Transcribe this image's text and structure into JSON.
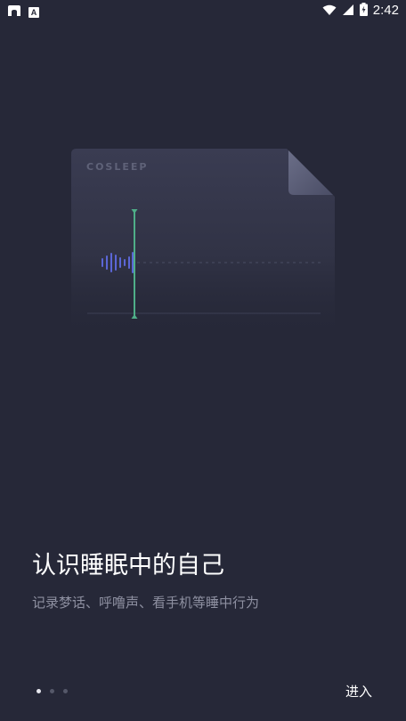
{
  "status_bar": {
    "time": "2:42",
    "icons": [
      "app-gallery-icon",
      "app-a-icon",
      "wifi-icon",
      "cell-signal-icon",
      "battery-charging-icon"
    ],
    "app_badge_letter": "A"
  },
  "illustration": {
    "doc_label": "COSLEEP",
    "icon": "sleep-recording-document-icon",
    "accent_color": "#4fae88",
    "wave_color": "#5b66d6"
  },
  "onboarding": {
    "headline": "认识睡眠中的自己",
    "subline": "记录梦话、呼噜声、看手机等睡中行为",
    "page_count": 3,
    "current_page": 1
  },
  "actions": {
    "enter_label": "进入"
  },
  "colors": {
    "background": "#262838",
    "text_primary": "#ffffff",
    "text_secondary": "#8e90a1",
    "dot_active": "#e6e7ee",
    "dot_inactive": "#555869"
  }
}
